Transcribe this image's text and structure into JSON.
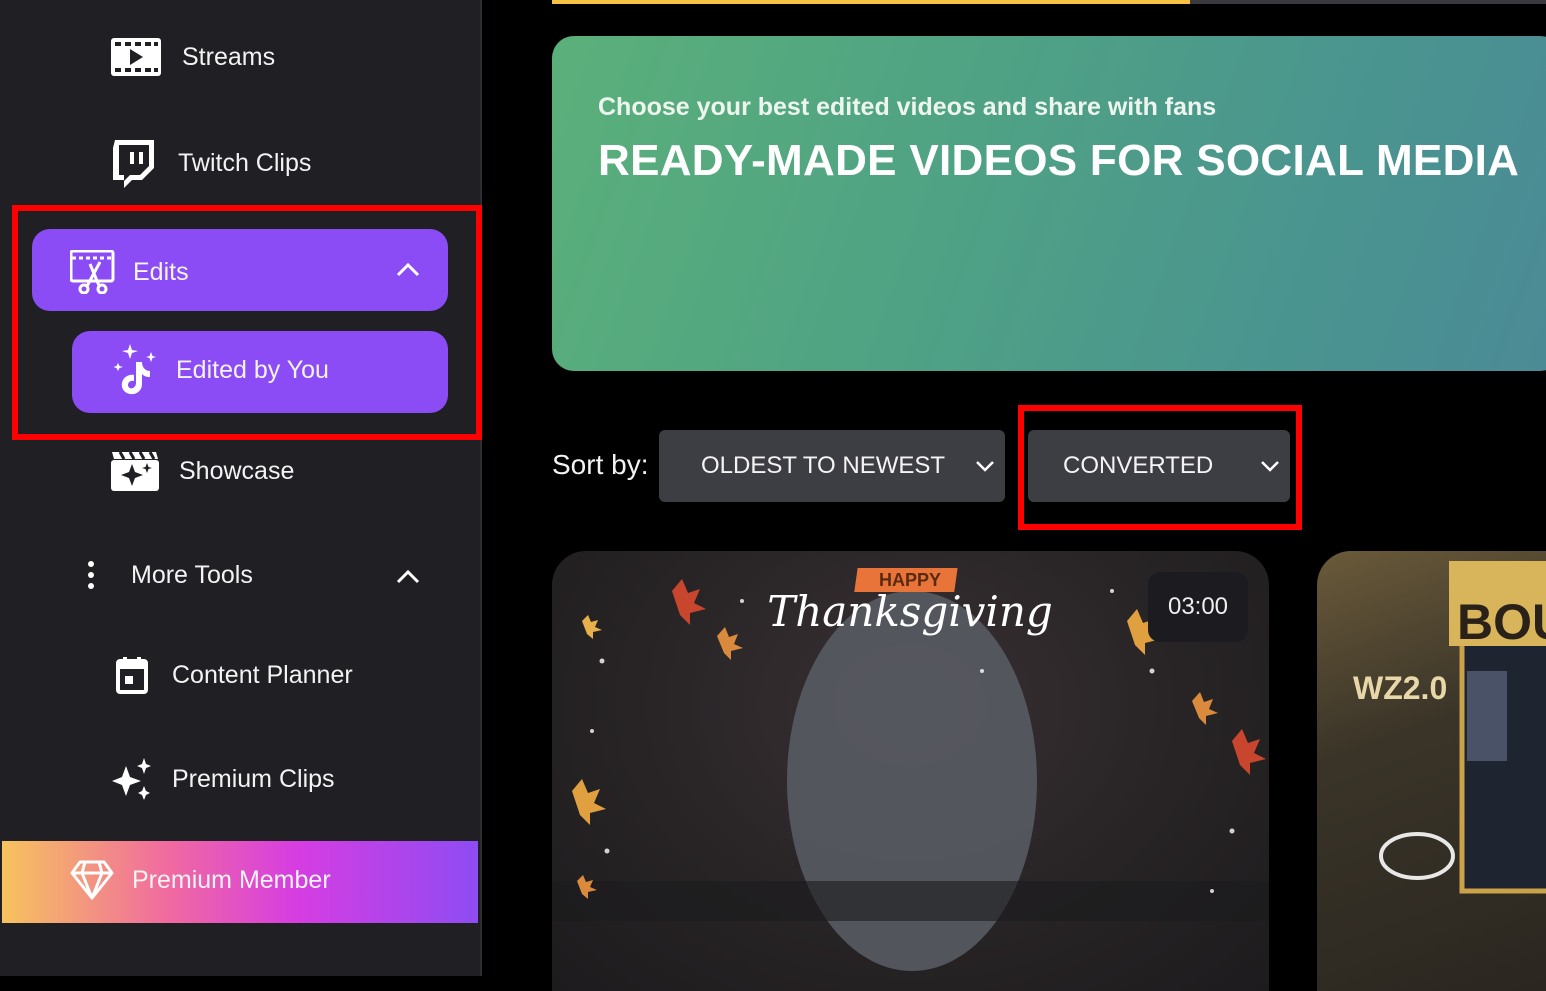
{
  "sidebar": {
    "streams": "Streams",
    "twitch_clips": "Twitch Clips",
    "edits": "Edits",
    "edited_by_you": "Edited by You",
    "showcase": "Showcase",
    "more_tools": "More Tools",
    "content_planner": "Content Planner",
    "premium_clips": "Premium Clips",
    "premium_member": "Premium Member"
  },
  "progress": {
    "fraction": 0.64,
    "fill_color": "#f5c242"
  },
  "banner": {
    "subtitle": "Choose your best edited videos and share with fans",
    "title": "READY-MADE VIDEOS FOR SOCIAL MEDIA"
  },
  "sort": {
    "label": "Sort by:",
    "order_value": "OLDEST TO NEWEST",
    "status_value": "CONVERTED"
  },
  "videos": [
    {
      "badge_top": "HAPPY",
      "badge_script": "Thanksgiving",
      "duration": "03:00"
    },
    {
      "overlay_text": "BOUN",
      "tag": "WZ2.0"
    }
  ],
  "colors": {
    "accent": "#8b4cf6",
    "highlight": "#ff0000",
    "sidebar_bg": "#1f1f24"
  },
  "icons": [
    "film-icon",
    "twitch-icon",
    "edit-video-icon",
    "chevron-up-icon",
    "tiktok-sparkle-icon",
    "showcase-icon",
    "kebab-icon",
    "calendar-icon",
    "sparkles-icon",
    "diamond-icon",
    "chevron-down-icon"
  ]
}
